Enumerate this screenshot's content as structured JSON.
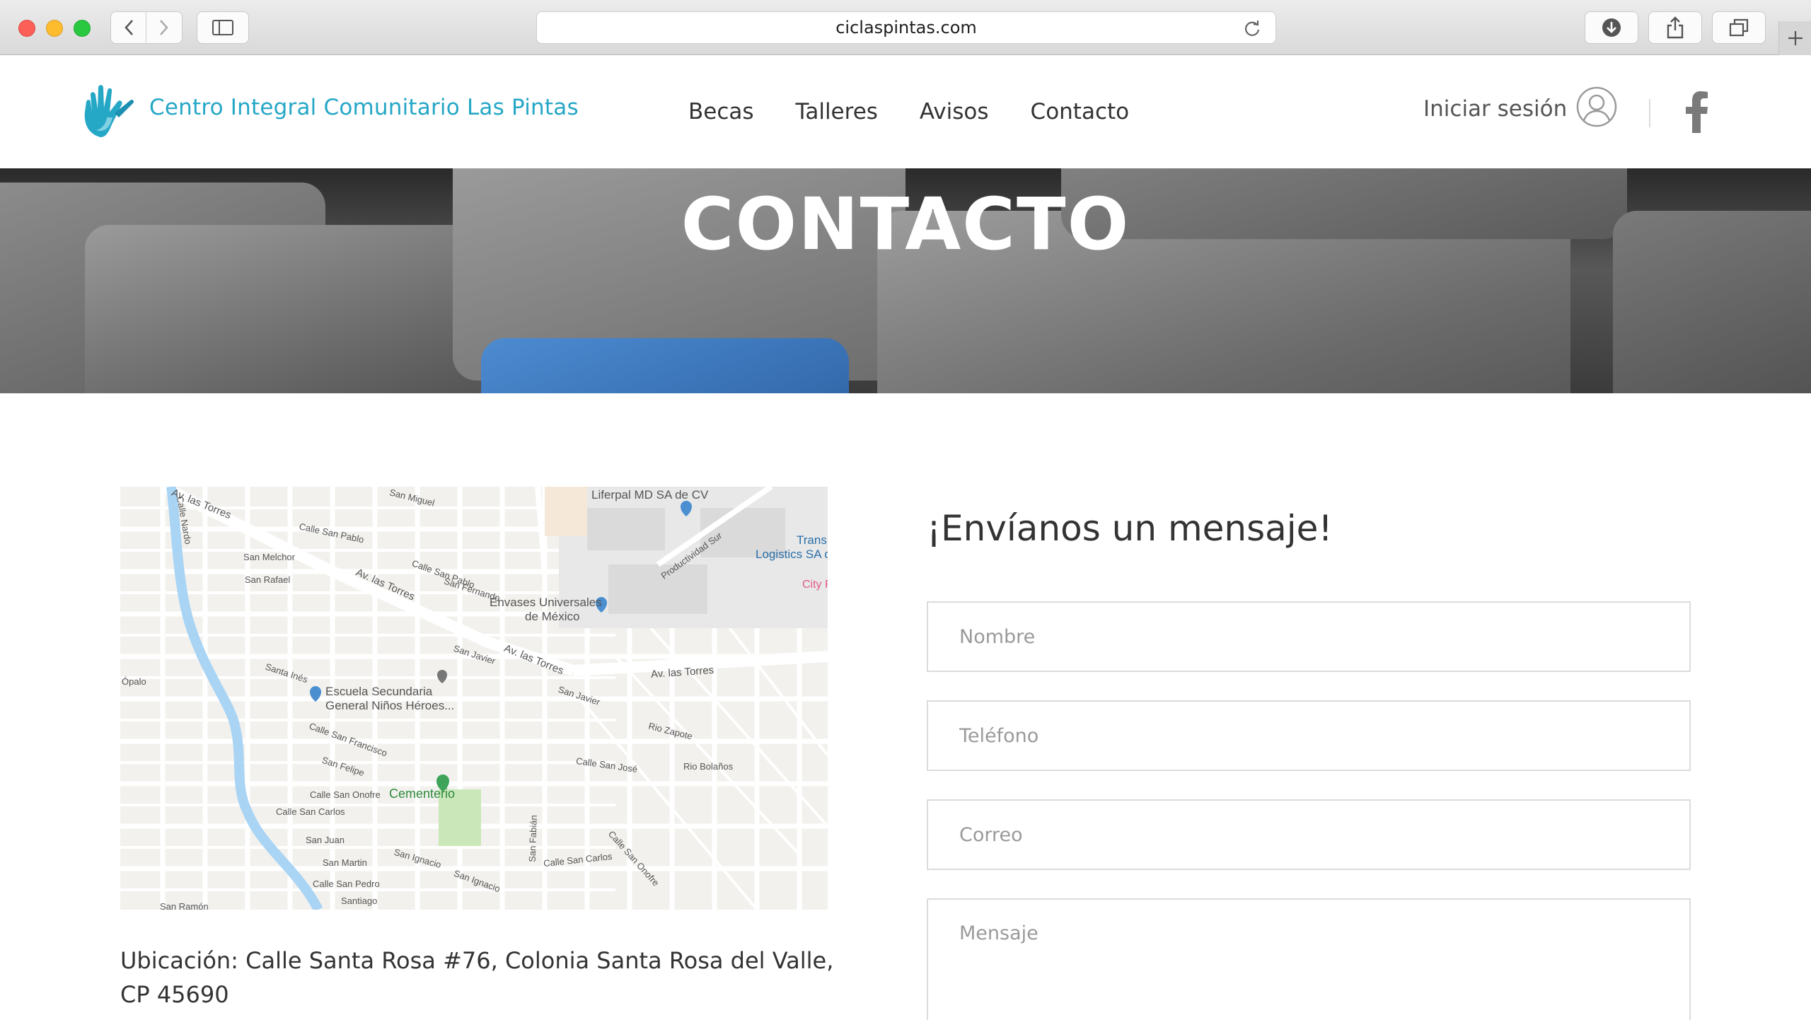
{
  "browser": {
    "url": "ciclaspintas.com"
  },
  "header": {
    "brand": "Centro Integral Comunitario Las Pintas",
    "nav": [
      "Becas",
      "Talleres",
      "Avisos",
      "Contacto"
    ],
    "login": "Iniciar sesión",
    "accent_color": "#25a7c6"
  },
  "hero": {
    "title": "CONTACTO"
  },
  "map": {
    "labels": {
      "av_torres_1": "Av. las Torres",
      "av_torres_2": "Av. las Torres",
      "av_torres_3": "Av. las Torres",
      "av_torres_4": "Av. las Torres",
      "liferpal": "Liferpal MD SA de CV",
      "trans1": "Trans",
      "trans2": "Logistics SA d",
      "city": "City F",
      "envases1": "Envases Universales",
      "envases2": "de México",
      "escuela1": "Escuela Secundaria",
      "escuela2": "General Niños Héroes...",
      "cementerio": "Cementerio",
      "productividad": "Productividad Sur",
      "san_pablo": "Calle San Pablo",
      "san_pablo2": "Calle San Pablo",
      "san_melchor": "San Melchor",
      "san_rafael": "San Rafael",
      "san_miguel": "San Miguel",
      "san_fernando": "San Fernando",
      "san_javier": "San Javier",
      "san_javier2": "San Javier",
      "santa_ines": "Santa Inés",
      "san_francisco": "Calle San Francisco",
      "san_felipe": "San Felipe",
      "san_onofre": "Calle San Onofre",
      "san_carlos": "Calle San Carlos",
      "san_juan": "San Juan",
      "san_martin": "San Martin",
      "san_pedro": "Calle San Pedro",
      "santiago": "Santiago",
      "san_ramon": "San Ramón",
      "san_ignacio": "San Ignacio",
      "san_ignacio2": "San Ignacio",
      "san_jose": "Calle San José",
      "rio_zapote": "Rio Zapote",
      "rio_bolanos": "Rio Bolaños",
      "opalo": "Ópalo",
      "calle_nardo": "Calle Nardo",
      "san_fabian": "San Fabián",
      "san_carlos2": "Calle San Carlos",
      "san_onofre2": "Calle San Onofre"
    }
  },
  "contact": {
    "location": "Ubicación: Calle Santa Rosa #76, Colonia Santa Rosa del Valle, CP 45690"
  },
  "form": {
    "title": "¡Envíanos un mensaje!",
    "name_placeholder": "Nombre",
    "phone_placeholder": "Teléfono",
    "email_placeholder": "Correo",
    "message_placeholder": "Mensaje"
  }
}
